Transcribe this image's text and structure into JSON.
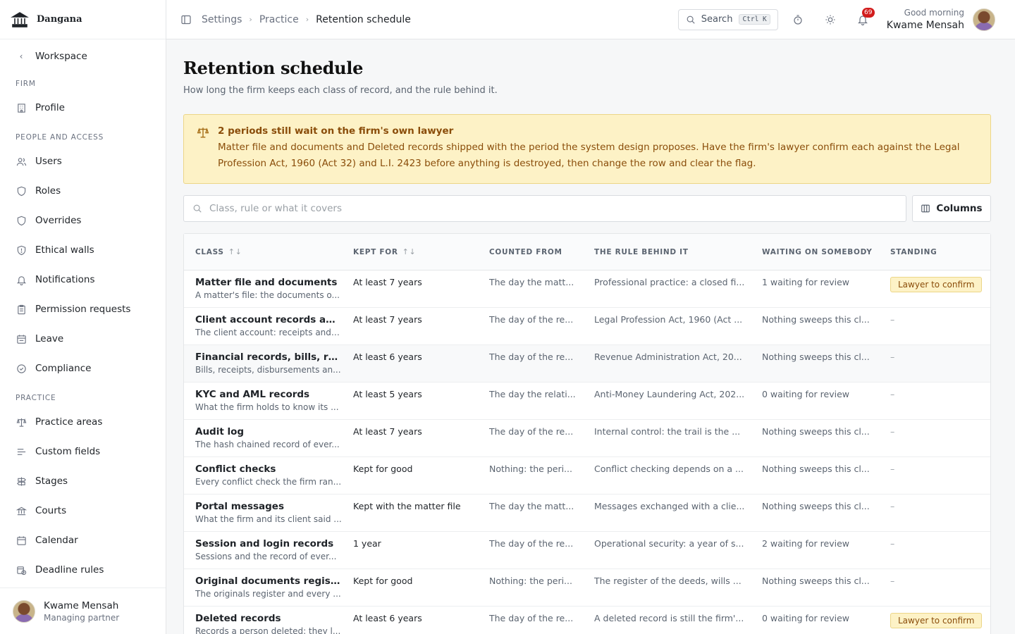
{
  "brand": {
    "name": "Dangana"
  },
  "sidebar": {
    "back_label": "Workspace",
    "sections": [
      {
        "title": "FIRM",
        "items": [
          {
            "label": "Profile",
            "icon": "building-icon"
          }
        ]
      },
      {
        "title": "PEOPLE AND ACCESS",
        "items": [
          {
            "label": "Users",
            "icon": "users-icon"
          },
          {
            "label": "Roles",
            "icon": "shield-icon"
          },
          {
            "label": "Overrides",
            "icon": "shield-icon"
          },
          {
            "label": "Ethical walls",
            "icon": "shield-icon"
          },
          {
            "label": "Notifications",
            "icon": "bell-icon"
          },
          {
            "label": "Permission requests",
            "icon": "clipboard-icon"
          },
          {
            "label": "Leave",
            "icon": "calendar-icon"
          },
          {
            "label": "Compliance",
            "icon": "check-circle-icon"
          }
        ]
      },
      {
        "title": "PRACTICE",
        "items": [
          {
            "label": "Practice areas",
            "icon": "scales-icon"
          },
          {
            "label": "Custom fields",
            "icon": "list-icon"
          },
          {
            "label": "Stages",
            "icon": "signpost-icon"
          },
          {
            "label": "Courts",
            "icon": "landmark-icon"
          },
          {
            "label": "Calendar",
            "icon": "calendar-icon"
          },
          {
            "label": "Deadline rules",
            "icon": "calendar-clock-icon"
          }
        ]
      }
    ],
    "user": {
      "name": "Kwame Mensah",
      "role": "Managing partner"
    }
  },
  "topbar": {
    "breadcrumbs": [
      "Settings",
      "Practice",
      "Retention schedule"
    ],
    "search_label": "Search",
    "search_shortcut": "Ctrl K",
    "notification_count": "69",
    "greeting": "Good morning",
    "user_name": "Kwame Mensah"
  },
  "page": {
    "title": "Retention schedule",
    "subtitle": "How long the firm keeps each class of record, and the rule behind it."
  },
  "alert": {
    "title": "2 periods still wait on the firm's own lawyer",
    "body": "Matter file and documents and Deleted records shipped with the period the system design proposes. Have the firm's lawyer confirm each against the Legal Profession Act, 1960 (Act 32) and L.I. 2423 before anything is destroyed, then change the row and clear the flag."
  },
  "filter": {
    "placeholder": "Class, rule or what it covers",
    "columns_label": "Columns"
  },
  "table": {
    "headers": [
      "CLASS",
      "KEPT FOR",
      "COUNTED FROM",
      "THE RULE BEHIND IT",
      "WAITING ON SOMEBODY",
      "STANDING"
    ],
    "rows": [
      {
        "name": "Matter file and documents",
        "desc": "A matter's file: the documents o...",
        "kept": "At least 7 years",
        "counted": "The day the matt...",
        "rule": "Professional practice: a closed fi...",
        "waiting": "1 waiting for review",
        "standing": "Lawyer to confirm"
      },
      {
        "name": "Client account records and...",
        "desc": "The client account: receipts and ...",
        "kept": "At least 7 years",
        "counted": "The day of the re...",
        "rule": "Legal Profession Act, 1960 (Act ...",
        "waiting": "Nothing sweeps this cl...",
        "standing": "–"
      },
      {
        "name": "Financial records, bills, rec...",
        "desc": "Bills, receipts, disbursements an...",
        "kept": "At least 6 years",
        "counted": "The day of the re...",
        "rule": "Revenue Administration Act, 20...",
        "waiting": "Nothing sweeps this cl...",
        "standing": "–"
      },
      {
        "name": "KYC and AML records",
        "desc": "What the firm holds to know its ...",
        "kept": "At least 5 years",
        "counted": "The day the relati...",
        "rule": "Anti-Money Laundering Act, 202...",
        "waiting": "0 waiting for review",
        "standing": "–"
      },
      {
        "name": "Audit log",
        "desc": "The hash chained record of ever...",
        "kept": "At least 7 years",
        "counted": "The day of the re...",
        "rule": "Internal control: the trail is the ...",
        "waiting": "Nothing sweeps this cl...",
        "standing": "–"
      },
      {
        "name": "Conflict checks",
        "desc": "Every conflict check the firm ran...",
        "kept": "Kept for good",
        "counted": "Nothing: the peri...",
        "rule": "Conflict checking depends on a ...",
        "waiting": "Nothing sweeps this cl...",
        "standing": "–"
      },
      {
        "name": "Portal messages",
        "desc": "What the firm and its client said ...",
        "kept": "Kept with the matter file",
        "counted": "The day the matt...",
        "rule": "Messages exchanged with a clie...",
        "waiting": "Nothing sweeps this cl...",
        "standing": "–"
      },
      {
        "name": "Session and login records",
        "desc": "Sessions and the record of ever...",
        "kept": "1 year",
        "counted": "The day of the re...",
        "rule": "Operational security: a year of s...",
        "waiting": "2 waiting for review",
        "standing": "–"
      },
      {
        "name": "Original documents register",
        "desc": "The originals register and every ...",
        "kept": "Kept for good",
        "counted": "Nothing: the peri...",
        "rule": "The register of the deeds, wills ...",
        "waiting": "Nothing sweeps this cl...",
        "standing": "–"
      },
      {
        "name": "Deleted records",
        "desc": "Records a person deleted: they l...",
        "kept": "At least 6 years",
        "counted": "The day of the re...",
        "rule": "A deleted record is still the firm'...",
        "waiting": "0 waiting for review",
        "standing": "Lawyer to confirm"
      }
    ]
  },
  "colors": {
    "alert_bg": "#fdf2c6",
    "alert_text": "#8a4d0a",
    "badge": "#d21c1c"
  }
}
